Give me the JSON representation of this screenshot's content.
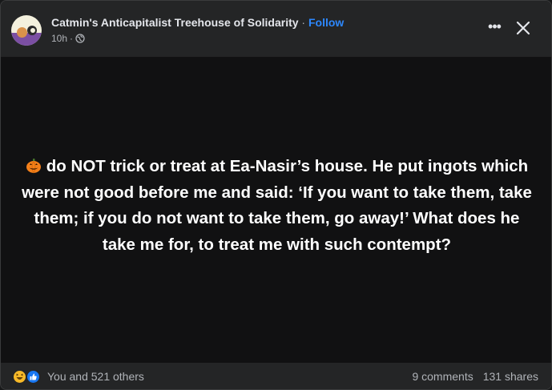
{
  "header": {
    "page_name": "Catmin's Anticapitalist Treehouse of Solidarity",
    "separator": " · ",
    "follow_label": "Follow",
    "timestamp": "10h",
    "meta_separator": "·",
    "privacy_icon": "globe-icon",
    "more_icon": "more-options-icon",
    "more_symbol": "•••",
    "close_icon": "close-icon"
  },
  "post": {
    "emoji_icon": "jack-o-lantern-icon",
    "text": "do NOT trick or treat at Ea-Nasir’s house. He put ingots which were not good before me and said: ‘If you want to take them, take them; if you do not want to take them, go away!’ What does he take me for, to treat me with such contempt?"
  },
  "footer": {
    "reaction_icons": [
      "haha-reaction-icon",
      "like-reaction-icon"
    ],
    "reactions_label": "You and 521 others",
    "comments_label": "9 comments",
    "shares_label": "131 shares"
  },
  "colors": {
    "background": "#242526",
    "content_background": "#111112",
    "accent": "#2d88ff",
    "secondary_text": "#b0b3b8"
  }
}
